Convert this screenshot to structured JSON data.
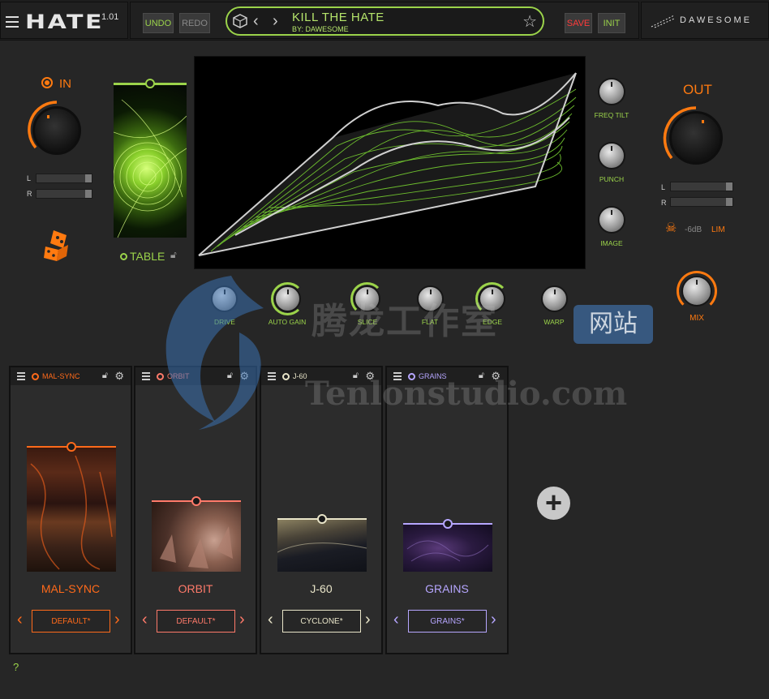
{
  "header": {
    "logo": "HATE",
    "version": "1.01",
    "undo_label": "UNDO",
    "redo_label": "REDO",
    "preset_name": "KILL THE HATE",
    "preset_author": "BY:  DAWESOME",
    "save_label": "SAVE",
    "init_label": "INIT",
    "brand": "DAWESOME"
  },
  "input": {
    "label": "IN",
    "meter_l": "L",
    "meter_r": "R"
  },
  "table": {
    "label": "TABLE"
  },
  "right_knobs": [
    {
      "label": "FREQ TILT"
    },
    {
      "label": "PUNCH"
    },
    {
      "label": "IMAGE"
    }
  ],
  "output": {
    "label": "OUT",
    "meter_l": "L",
    "meter_r": "R",
    "limiter_db": "-6dB",
    "limiter_label": "LIM",
    "mix_label": "MIX"
  },
  "bottom_knobs": [
    {
      "label": "DRIVE"
    },
    {
      "label": "AUTO GAIN"
    },
    {
      "label": "SLICE"
    },
    {
      "label": "FLAT"
    },
    {
      "label": "EDGE"
    },
    {
      "label": "WARP"
    }
  ],
  "modules": [
    {
      "title": "MAL-SYNC",
      "name": "MAL-SYNC",
      "preset": "DEFAULT*",
      "color": "#ff6a1a"
    },
    {
      "title": "ORBIT",
      "name": "ORBIT",
      "preset": "DEFAULT*",
      "color": "#ff7a6a"
    },
    {
      "title": "J-60",
      "name": "J-60",
      "preset": "CYCLONE*",
      "color": "#e8e4c8"
    },
    {
      "title": "GRAINS",
      "name": "GRAINS",
      "preset": "GRAINS*",
      "color": "#b6a6ff"
    }
  ],
  "help_label": "?",
  "watermark": {
    "cn": "腾龙工作室",
    "site": "网站",
    "url": "Tenlonstudio.com"
  },
  "colors": {
    "accent_green": "#9bd34a",
    "accent_orange": "#ff7a10",
    "save_red": "#ff3a3a"
  }
}
